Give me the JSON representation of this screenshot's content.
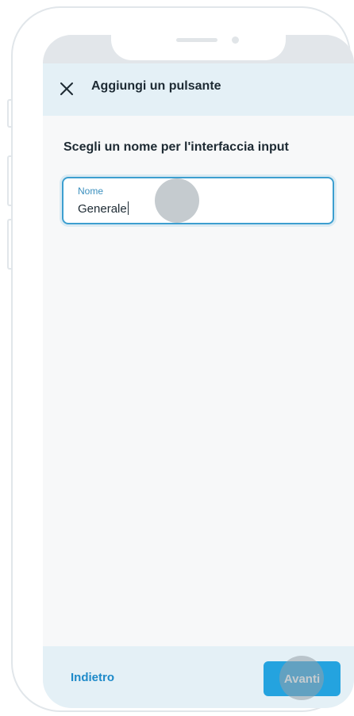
{
  "header": {
    "title": "Aggiungi un pulsante",
    "close_icon": "close-icon"
  },
  "main": {
    "heading": "Scegli un nome per l'interfaccia input",
    "name_field": {
      "label": "Nome",
      "value": "Generale"
    }
  },
  "footer": {
    "back_label": "Indietro",
    "next_label": "Avanti"
  },
  "colors": {
    "accent": "#24a3df",
    "header_bg": "#e4f0f6",
    "link": "#1e8ac9",
    "text": "#1d2a33"
  }
}
